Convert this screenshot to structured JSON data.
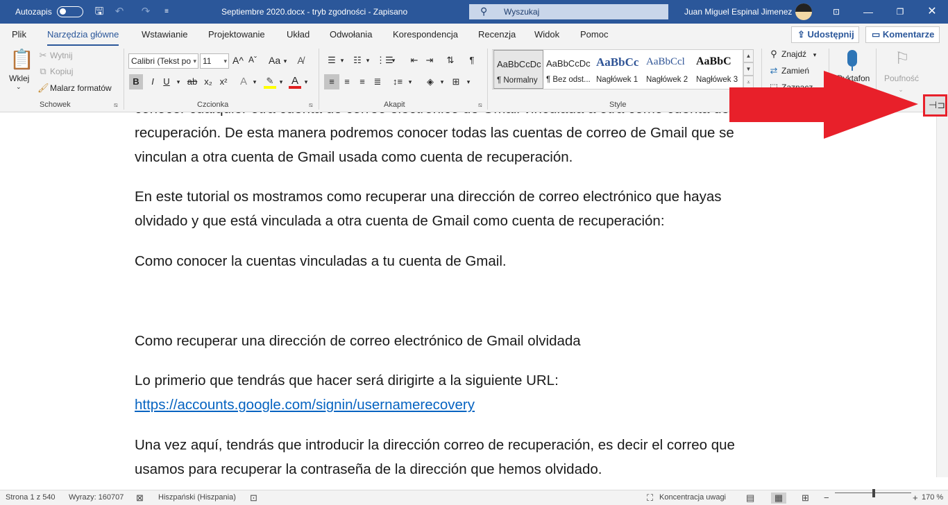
{
  "titlebar": {
    "autosave_label": "Autozapis",
    "doc_title": "Septiembre 2020.docx  -  tryb zgodności  -  Zapisano",
    "search_placeholder": "Wyszukaj",
    "user_name": "Juan Miguel Espinal Jimenez",
    "accent_color": "#2b579a"
  },
  "tabs": [
    "Plik",
    "Narzędzia główne",
    "Wstawianie",
    "Projektowanie",
    "Układ",
    "Odwołania",
    "Korespondencja",
    "Recenzja",
    "Widok",
    "Pomoc"
  ],
  "active_tab": "Narzędzia główne",
  "share_label": "Udostępnij",
  "comments_label": "Komentarze",
  "clipboard": {
    "paste": "Wklej",
    "cut": "Wytnij",
    "copy": "Kopiuj",
    "painter": "Malarz formatów",
    "group": "Schowek"
  },
  "font": {
    "name": "Calibri (Tekst po",
    "size": "11",
    "bold": "B",
    "italic": "I",
    "underline": "U",
    "strike": "ab",
    "subscript": "x₂",
    "superscript": "x²",
    "grow": "A^",
    "shrink": "Aˇ",
    "case": "Aa",
    "group": "Czcionka"
  },
  "paragraph": {
    "group": "Akapit"
  },
  "styles": {
    "items": [
      {
        "preview": "AaBbCcDc",
        "name": "¶ Normalny"
      },
      {
        "preview": "AaBbCcDc",
        "name": "¶ Bez odst..."
      },
      {
        "preview": "AaBbCc",
        "name": "Nagłówek 1"
      },
      {
        "preview": "AaBbCcl",
        "name": "Nagłówek 2"
      },
      {
        "preview": "AaBbC",
        "name": "Nagłówek 3"
      }
    ],
    "group": "Style"
  },
  "editing": {
    "find": "Znajdź",
    "replace": "Zamień",
    "select": "Zaznacz"
  },
  "dictate": "Dyktafon",
  "sensitivity": "Poufność",
  "document": {
    "lines": [
      "conocer cualquier otra cuenta de correo electrónico de Gmail vinculada a otra como cuenta de",
      "recuperación. De esta manera podremos conocer todas las cuentas de correo de Gmail que se",
      "vinculan a otra cuenta de Gmail usada como cuenta de recuperación.",
      "En este tutorial os mostramos como recuperar una dirección de correo electrónico que hayas",
      "olvidado y que está vinculada a otra cuenta de Gmail como cuenta de recuperación:",
      "Como conocer la cuentas vinculadas a tu cuenta de Gmail.",
      "Como recuperar una dirección de correo electrónico de Gmail olvidada",
      "Lo primerio que tendrás que hacer será dirigirte a la siguiente URL:",
      "https://accounts.google.com/signin/usernamerecovery",
      "Una vez aquí, tendrás que introducir la dirección correo de recuperación, es decir el correo que",
      "usamos para recuperar la contraseña de la dirección que hemos olvidado."
    ]
  },
  "status": {
    "page": "Strona 1 z 540",
    "words": "Wyrazy: 160707",
    "language": "Hiszpański (Hiszpania)",
    "focus": "Koncentracja uwagi",
    "zoom": "170 %"
  },
  "annotation_color": "#e8202a"
}
